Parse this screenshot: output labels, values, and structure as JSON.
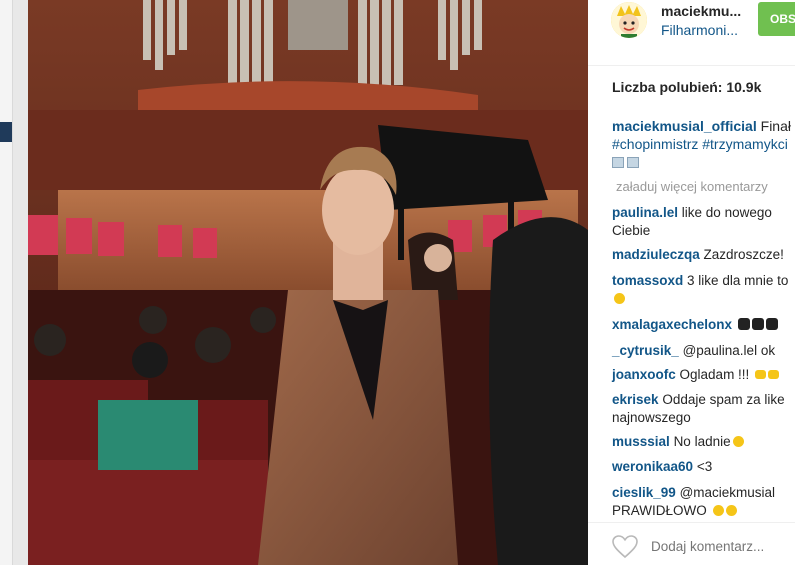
{
  "post": {
    "username": "maciekmu...",
    "location": "Filharmoni...",
    "follow_label": "OBS"
  },
  "likes": {
    "label": "Liczba polubień:",
    "count": "10.9k"
  },
  "caption": {
    "username": "maciekmusial_official",
    "text": "Finał",
    "tags": "#chopinmistrz #trzymamykci"
  },
  "load_more": "załaduj więcej komentarzy",
  "comments": [
    {
      "user": "paulina.lel",
      "text": "like do nowego",
      "text2": "Ciebie"
    },
    {
      "user": "madziuleczqa",
      "text": "Zazdroszcze!"
    },
    {
      "user": "tomassoxd",
      "text": "3 like dla mnie to"
    },
    {
      "user": "xmalagaxechelonx",
      "text": ""
    },
    {
      "user": "_cytrusik_",
      "text": "@paulina.lel ok"
    },
    {
      "user": "joanxoofc",
      "text": "Ogladam !!!"
    },
    {
      "user": "ekrisek",
      "text": "Oddaje spam za like",
      "text2": "najnowszego"
    },
    {
      "user": "musssial",
      "text": "No ladnie"
    },
    {
      "user": "weronikaa60",
      "text": "<3"
    },
    {
      "user": "cieslik_99",
      "text": "@maciekmusial",
      "text2": "PRAWIDŁOWO"
    }
  ],
  "add_comment_placeholder": "Dodaj komentarz...",
  "colors": {
    "link": "#125688",
    "follow": "#70c050",
    "muted": "#999999"
  }
}
